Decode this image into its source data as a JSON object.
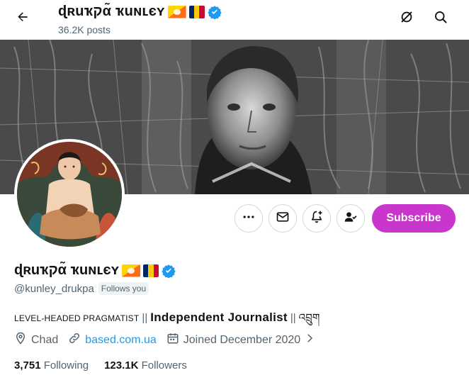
{
  "header": {
    "display_name": "ɖʀuҡקα̃ ҡuɴʟєʏ",
    "posts_count": "36.2K posts",
    "back_icon": "arrow-left-icon",
    "grok_icon": "grok-icon",
    "search_icon": "search-icon"
  },
  "profile": {
    "display_name": "ɖʀuҡקα̃ ҡuɴʟєʏ",
    "handle": "@kunley_drukpa",
    "follows_you": "Follows you",
    "bio": {
      "part1": "LEVEL-HEADED PRAGMATIST",
      "sep1": "||",
      "part2": "Independent Journalist",
      "sep2": "||",
      "part3": "འབྲུག"
    },
    "location": "Chad",
    "website": "based.com.ua",
    "joined": "Joined December 2020",
    "following_count": "3,751",
    "following_label": "Following",
    "followers_count": "123.1K",
    "followers_label": "Followers"
  },
  "actions": {
    "more_icon": "more-icon",
    "message_icon": "mail-icon",
    "notify_icon": "bell-plus-icon",
    "following_icon": "person-check-icon",
    "subscribe_label": "Subscribe"
  },
  "colors": {
    "subscribe": "#c936cc",
    "link": "#1d9bf0",
    "verified": "#1d9bf0",
    "secondary_text": "#536471"
  }
}
